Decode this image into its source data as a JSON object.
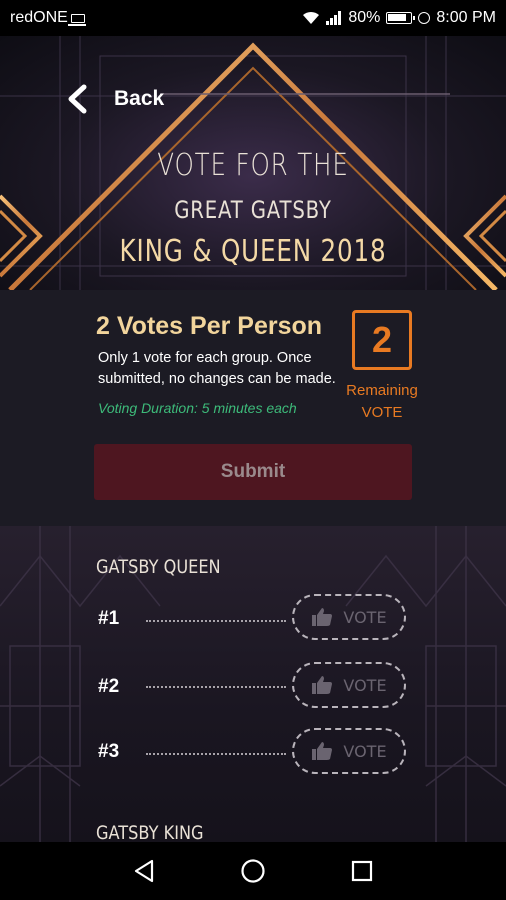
{
  "status_bar": {
    "carrier": "redONE",
    "battery": "80%",
    "time": "8:00 PM",
    "icons": [
      "laptop-icon",
      "wifi-icon",
      "signal-icon",
      "battery-icon",
      "clock-icon"
    ]
  },
  "header": {
    "back_label": "Back",
    "title_line1": "VOTE FOR THE",
    "title_line2": "GREAT GATSBY",
    "title_line3": "KING & QUEEN 2018"
  },
  "info": {
    "votes_title": "2 Votes Per Person",
    "description": "Only 1 vote for each group. Once submitted, no changes can be made.",
    "duration": "Voting Duration: 5 minutes each",
    "remaining_count": "2",
    "remaining_line1": "Remaining",
    "remaining_line2": "VOTE",
    "submit_label": "Submit"
  },
  "groups": {
    "queen": {
      "title": "GATSBY QUEEN",
      "entries": [
        {
          "rank": "#1",
          "vote_label": "VOTE"
        },
        {
          "rank": "#2",
          "vote_label": "VOTE"
        },
        {
          "rank": "#3",
          "vote_label": "VOTE"
        }
      ]
    },
    "king": {
      "title": "GATSBY KING"
    }
  },
  "colors": {
    "accent_orange": "#e87a22",
    "gold": "#f2d59c",
    "green": "#3dbb7a",
    "submit_bg": "#4e1620"
  }
}
